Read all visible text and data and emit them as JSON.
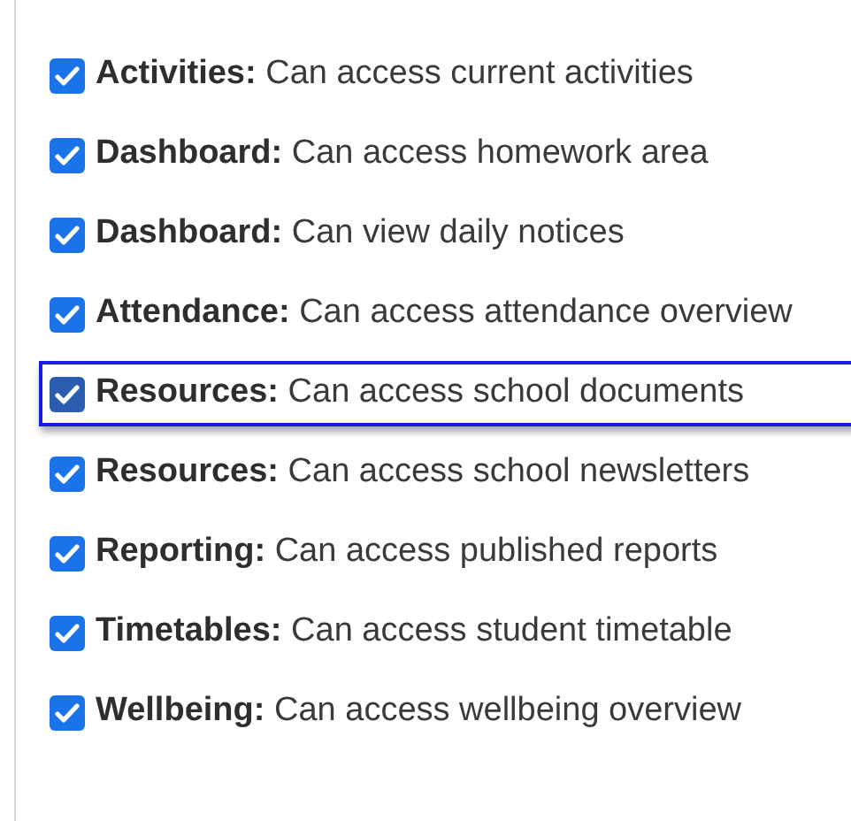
{
  "permissions": [
    {
      "category": "Activities:",
      "description": "Can access current activities",
      "checked": true,
      "focused": false
    },
    {
      "category": "Dashboard:",
      "description": "Can access homework area",
      "checked": true,
      "focused": false
    },
    {
      "category": "Dashboard:",
      "description": "Can view daily notices",
      "checked": true,
      "focused": false
    },
    {
      "category": "Attendance:",
      "description": "Can access attendance overview",
      "checked": true,
      "focused": false
    },
    {
      "category": "Resources:",
      "description": "Can access school documents",
      "checked": true,
      "focused": true
    },
    {
      "category": "Resources:",
      "description": "Can access school newsletters",
      "checked": true,
      "focused": false
    },
    {
      "category": "Reporting:",
      "description": "Can access published reports",
      "checked": true,
      "focused": false
    },
    {
      "category": "Timetables:",
      "description": "Can access student timetable",
      "checked": true,
      "focused": false
    },
    {
      "category": "Wellbeing:",
      "description": "Can access wellbeing overview",
      "checked": true,
      "focused": false
    }
  ]
}
